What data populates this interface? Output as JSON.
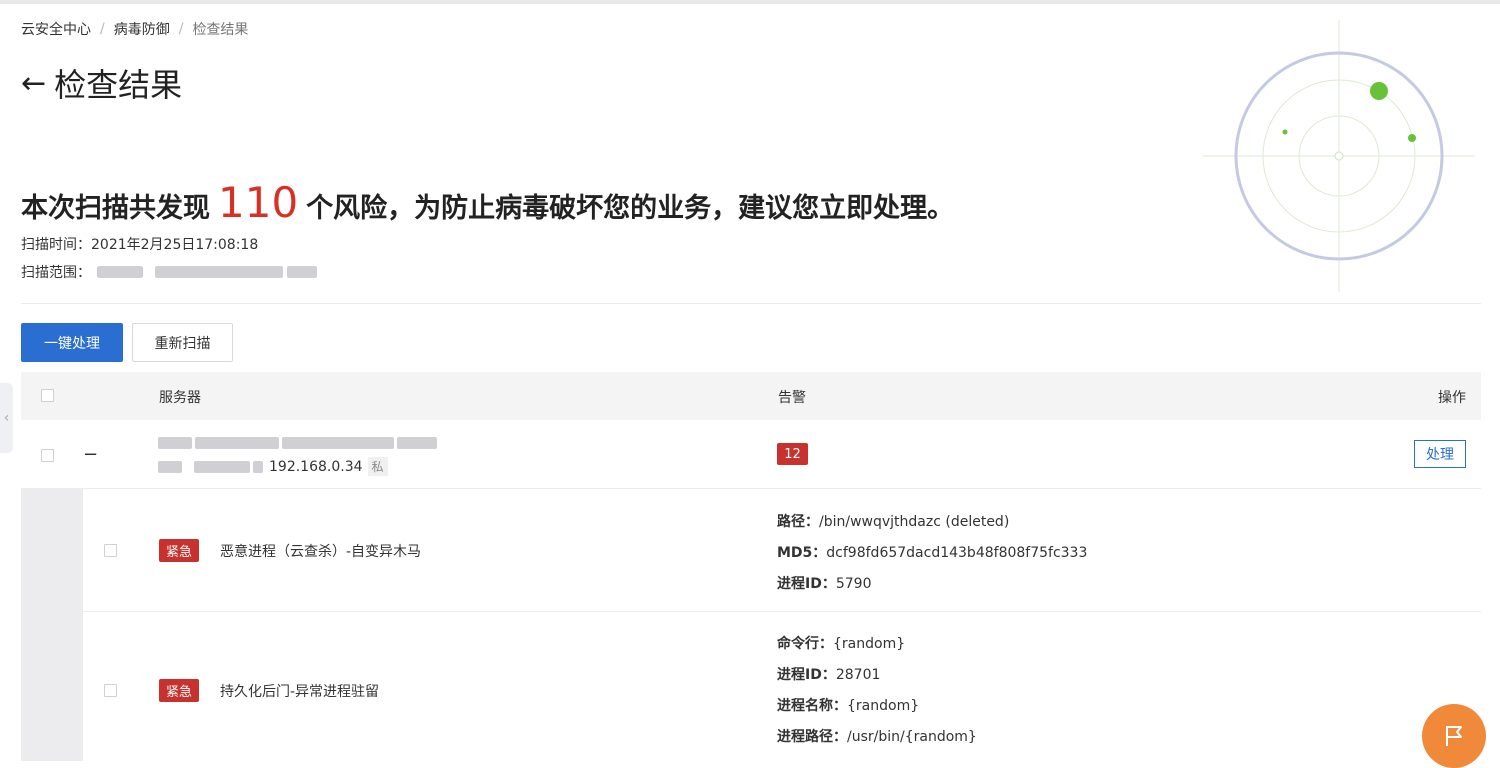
{
  "breadcrumb": {
    "items": [
      "云安全中心",
      "病毒防御",
      "检查结果"
    ],
    "separator": "/"
  },
  "page": {
    "back_icon": "arrow-left-icon",
    "title": "检查结果"
  },
  "summary": {
    "prefix": "本次扫描共发现",
    "count": "110",
    "suffix": "个风险，为防止病毒破坏您的业务，建议您立即处理。",
    "scan_time_label": "扫描时间：",
    "scan_time_value": "2021年2月25日17:08:18",
    "scan_scope_label": "扫描范围："
  },
  "toolbar": {
    "primary_label": "一键处理",
    "rescan_label": "重新扫描"
  },
  "table": {
    "headers": {
      "server": "服务器",
      "alert": "告警",
      "operation": "操作"
    },
    "server_row": {
      "collapse_symbol": "−",
      "ip": "192.168.0.34",
      "ip_tag": "私",
      "alert_count": "12",
      "action_label": "处理"
    },
    "alerts": [
      {
        "level": "紧急",
        "name": "恶意进程（云查杀）-自变异木马",
        "details": [
          {
            "key": "路径：",
            "value": "/bin/wwqvjthdazc (deleted)"
          },
          {
            "key": "MD5：",
            "value": "dcf98fd657dacd143b48f808f75fc333"
          },
          {
            "key": "进程ID：",
            "value": "5790"
          }
        ]
      },
      {
        "level": "紧急",
        "name": "持久化后门-异常进程驻留",
        "details": [
          {
            "key": "命令行：",
            "value": "{random}"
          },
          {
            "key": "进程ID：",
            "value": "28701"
          },
          {
            "key": "进程名称：",
            "value": "{random}"
          },
          {
            "key": "进程路径：",
            "value": "/usr/bin/{random}"
          }
        ]
      }
    ]
  },
  "colors": {
    "primary": "#2b6ed2",
    "danger": "#c8322e",
    "count_red": "#d93026",
    "fab_orange": "#f08a3a",
    "radar_ring": "#c5cae3",
    "radar_dot": "#67c23a"
  },
  "icons": {
    "radar": "radar-scan-icon",
    "fab": "flag-icon",
    "side_handle": "chevron-left-icon"
  }
}
